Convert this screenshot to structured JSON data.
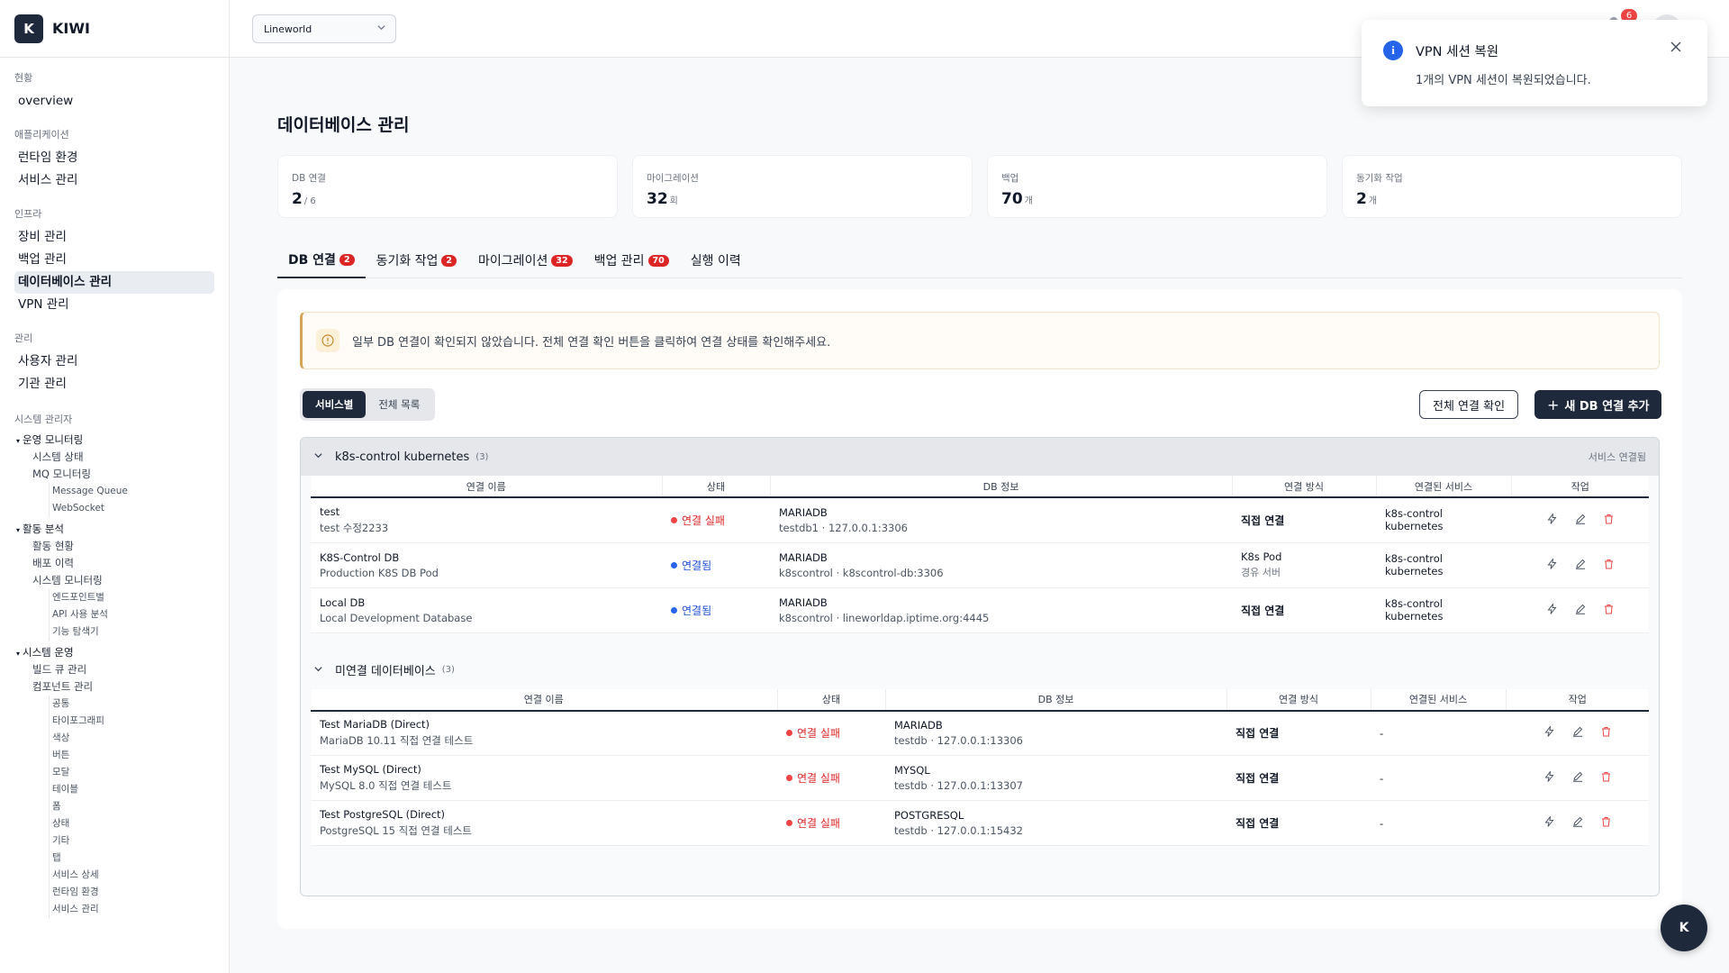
{
  "brand": {
    "logo": "K",
    "name": "KIWI"
  },
  "org_select": {
    "value": "Lineworld"
  },
  "notifications": {
    "count": "6"
  },
  "sidebar": {
    "sections": [
      {
        "title": "현황",
        "items": [
          {
            "label": "overview"
          }
        ]
      },
      {
        "title": "애플리케이션",
        "items": [
          {
            "label": "런타임 환경"
          },
          {
            "label": "서비스 관리"
          }
        ]
      },
      {
        "title": "인프라",
        "items": [
          {
            "label": "장비 관리"
          },
          {
            "label": "백업 관리"
          },
          {
            "label": "데이터베이스 관리",
            "active": true
          },
          {
            "label": "VPN 관리"
          }
        ]
      },
      {
        "title": "관리",
        "items": [
          {
            "label": "사용자 관리"
          },
          {
            "label": "기관 관리"
          }
        ]
      }
    ],
    "admin": {
      "title": "시스템 관리자",
      "g1": {
        "label": "운영 모니터링",
        "sys_status": "시스템 상태",
        "mq": "MQ 모니터링",
        "mq_children": [
          "Message Queue",
          "WebSocket"
        ]
      },
      "g2": {
        "label": "활동 분석",
        "items": [
          "활동 현황",
          "배포 이력",
          "시스템 모니터링"
        ],
        "monitor_children": [
          "엔드포인트별",
          "API 사용 분석",
          "기능 탐색기"
        ]
      },
      "g3": {
        "label": "시스템 운영",
        "items": [
          "빌드 큐 관리",
          "컴포넌트 관리"
        ],
        "component_children": [
          "공통",
          "타이포그래피",
          "색상",
          "버튼",
          "모달",
          "테이블",
          "폼",
          "상태",
          "기타",
          "탭",
          "서비스 상세",
          "런타임 환경",
          "서비스 관리"
        ]
      }
    }
  },
  "page": {
    "title": "데이터베이스 관리"
  },
  "stats": [
    {
      "label": "DB 연결",
      "value": "2",
      "unit": "/ 6"
    },
    {
      "label": "마이그레이션",
      "value": "32",
      "unit": "회"
    },
    {
      "label": "백업",
      "value": "70",
      "unit": "개"
    },
    {
      "label": "동기화 작업",
      "value": "2",
      "unit": "개"
    }
  ],
  "tabs": [
    {
      "label": "DB 연결",
      "badge": "2"
    },
    {
      "label": "동기화 작업",
      "badge": "2"
    },
    {
      "label": "마이그레이션",
      "badge": "32"
    },
    {
      "label": "백업 관리",
      "badge": "70"
    },
    {
      "label": "실행 이력",
      "badge": ""
    }
  ],
  "alert": {
    "text": "일부 DB 연결이 확인되지 않았습니다. 전체 연결 확인 버튼을 클릭하여 연결 상태를 확인해주세요."
  },
  "view_toggle": {
    "by_service": "서비스별",
    "all": "전체 목록"
  },
  "buttons": {
    "check_all": "전체 연결 확인",
    "add": "새 DB 연결 추가"
  },
  "columns": {
    "name": "연결 이름",
    "status": "상태",
    "db": "DB 정보",
    "method": "연결 방식",
    "service": "연결된 서비스",
    "actions": "작업"
  },
  "group1": {
    "title": "k8s-control kubernetes",
    "count": "(3)",
    "link": "서비스 연결됨",
    "rows": [
      {
        "name": "test",
        "desc": "test 수정2233",
        "status": "연결 실패",
        "db_type": "MARIADB",
        "db_addr": "testdb1 · 127.0.0.1:3306",
        "method": "직접 연결",
        "method_sub": "",
        "service": "k8s-control kubernetes"
      },
      {
        "name": "K8S-Control DB",
        "desc": "Production K8S DB Pod",
        "status": "연결됨",
        "db_type": "MARIADB",
        "db_addr": "k8scontrol · k8scontrol-db:3306",
        "method": "K8s Pod",
        "method_sub": "경유 서버",
        "service": "k8s-control kubernetes"
      },
      {
        "name": "Local DB",
        "desc": "Local Development Database",
        "status": "연결됨",
        "db_type": "MARIADB",
        "db_addr": "k8scontrol · lineworldap.iptime.org:4445",
        "method": "직접 연결",
        "method_sub": "",
        "service": "k8s-control kubernetes"
      }
    ]
  },
  "group2": {
    "title": "미연결 데이터베이스",
    "count": "(3)",
    "rows": [
      {
        "name": "Test MariaDB (Direct)",
        "desc": "MariaDB 10.11 직접 연결 테스트",
        "status": "연결 실패",
        "db_type": "MARIADB",
        "db_addr": "testdb · 127.0.0.1:13306",
        "method": "직접 연결",
        "service": "-"
      },
      {
        "name": "Test MySQL (Direct)",
        "desc": "MySQL 8.0 직접 연결 테스트",
        "status": "연결 실패",
        "db_type": "MYSQL",
        "db_addr": "testdb · 127.0.0.1:13307",
        "method": "직접 연결",
        "service": "-"
      },
      {
        "name": "Test PostgreSQL (Direct)",
        "desc": "PostgreSQL 15 직접 연결 테스트",
        "status": "연결 실패",
        "db_type": "POSTGRESQL",
        "db_addr": "testdb · 127.0.0.1:15432",
        "method": "직접 연결",
        "service": "-"
      }
    ]
  },
  "toast": {
    "title": "VPN 세션 복원",
    "message": "1개의 VPN 세션이 복원되었습니다."
  },
  "fab": {
    "label": "K"
  },
  "colors": {
    "primary": "#1e293b",
    "danger": "#ef4444",
    "success_blue": "#2563eb",
    "warning": "#d6a456"
  }
}
